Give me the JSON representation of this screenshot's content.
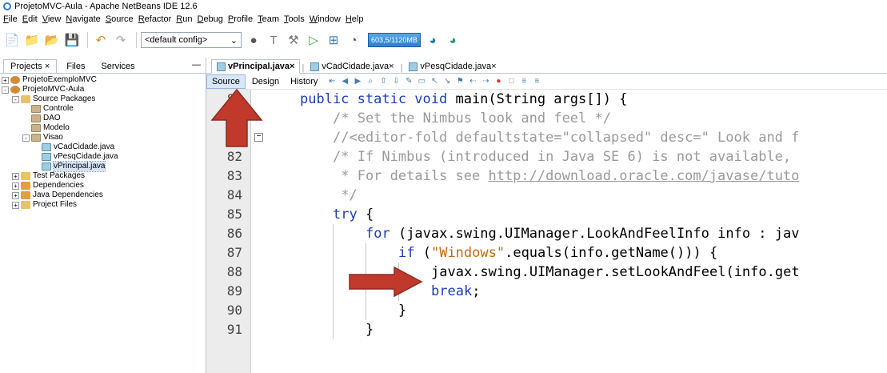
{
  "window": {
    "title": "ProjetoMVC-Aula - Apache NetBeans IDE 12.6"
  },
  "menu": [
    "File",
    "Edit",
    "View",
    "Navigate",
    "Source",
    "Refactor",
    "Run",
    "Debug",
    "Profile",
    "Team",
    "Tools",
    "Window",
    "Help"
  ],
  "toolbar": {
    "config_select": "<default config>",
    "memory": "603,5/1120MB",
    "icons": [
      "new-file-icon",
      "new-project-icon",
      "open-project-icon",
      "save-all-icon",
      "undo-icon",
      "redo-icon",
      "globe-icon",
      "clean-build-icon",
      "build-icon",
      "run-icon",
      "debug-icon",
      "profile-icon",
      "gc-icon",
      "gc2-icon"
    ]
  },
  "left_panel": {
    "tabs": [
      "Projects",
      "Files",
      "Services"
    ],
    "tree": [
      {
        "label": "ProjetoExemploMVC",
        "level": 0,
        "icon": "project",
        "expander": "+"
      },
      {
        "label": "ProjetoMVC-Aula",
        "level": 0,
        "icon": "project",
        "expander": "-"
      },
      {
        "label": "Source Packages",
        "level": 1,
        "icon": "folder",
        "expander": "-"
      },
      {
        "label": "Controle",
        "level": 2,
        "icon": "package",
        "expander": ""
      },
      {
        "label": "DAO",
        "level": 2,
        "icon": "package",
        "expander": ""
      },
      {
        "label": "Modelo",
        "level": 2,
        "icon": "package",
        "expander": ""
      },
      {
        "label": "Visao",
        "level": 2,
        "icon": "package",
        "expander": "-"
      },
      {
        "label": "vCadCidade.java",
        "level": 3,
        "icon": "java",
        "expander": ""
      },
      {
        "label": "vPesqCidade.java",
        "level": 3,
        "icon": "java",
        "expander": ""
      },
      {
        "label": "vPrincipal.java",
        "level": 3,
        "icon": "java",
        "expander": "",
        "selected": true
      },
      {
        "label": "Test Packages",
        "level": 1,
        "icon": "folder",
        "expander": "+"
      },
      {
        "label": "Dependencies",
        "level": 1,
        "icon": "lib",
        "expander": "+"
      },
      {
        "label": "Java Dependencies",
        "level": 1,
        "icon": "lib",
        "expander": "+"
      },
      {
        "label": "Project Files",
        "level": 1,
        "icon": "folder",
        "expander": "+"
      }
    ]
  },
  "editor": {
    "tabs": [
      {
        "label": "vPrincipal.java",
        "active": true
      },
      {
        "label": "vCadCidade.java",
        "active": false
      },
      {
        "label": "vPesqCidade.java",
        "active": false
      }
    ],
    "views": [
      "Source",
      "Design",
      "History"
    ],
    "active_view": "Source",
    "lines": [
      {
        "num": "80",
        "indent": 4,
        "parts": [
          [
            "kw",
            "public static void "
          ],
          [
            "",
            "main(String args[]) {"
          ]
        ]
      },
      {
        "num": "",
        "indent": 8,
        "parts": [
          [
            "cm",
            "/* Set the Nimbus look and feel */"
          ]
        ]
      },
      {
        "num": "81",
        "indent": 8,
        "parts": [
          [
            "cm",
            "//<editor-fold defaultstate=\"collapsed\" desc=\" Look and f"
          ]
        ],
        "fold": true
      },
      {
        "num": "82",
        "indent": 8,
        "parts": [
          [
            "cm",
            "/* If Nimbus (introduced in Java SE 6) is not available,"
          ]
        ]
      },
      {
        "num": "83",
        "indent": 8,
        "parts": [
          [
            "cm",
            " * For details see "
          ],
          [
            "link",
            "http://download.oracle.com/javase/tuto"
          ]
        ]
      },
      {
        "num": "84",
        "indent": 8,
        "parts": [
          [
            "cm",
            " */"
          ]
        ]
      },
      {
        "num": "85",
        "indent": 8,
        "parts": [
          [
            "kw",
            "try"
          ],
          [
            "",
            " {"
          ]
        ]
      },
      {
        "num": "86",
        "indent": 12,
        "parts": [
          [
            "kw",
            "for"
          ],
          [
            "",
            " (javax.swing.UIManager.LookAndFeelInfo info : jav"
          ]
        ]
      },
      {
        "num": "87",
        "indent": 16,
        "parts": [
          [
            "kw",
            "if"
          ],
          [
            "",
            " ("
          ],
          [
            "str",
            "\"Windows\""
          ],
          [
            "",
            ".equals(info.getName())) {"
          ]
        ]
      },
      {
        "num": "88",
        "indent": 20,
        "parts": [
          [
            "",
            "javax.swing.UIManager.setLookAndFeel(info.get"
          ]
        ]
      },
      {
        "num": "89",
        "indent": 20,
        "parts": [
          [
            "kw",
            "break"
          ],
          [
            "",
            ";"
          ]
        ]
      },
      {
        "num": "90",
        "indent": 16,
        "parts": [
          [
            "",
            "}"
          ]
        ]
      },
      {
        "num": "91",
        "indent": 12,
        "parts": [
          [
            "",
            "}"
          ]
        ]
      }
    ]
  },
  "colors": {
    "arrow_red": "#c0392b",
    "keyword": "#1f3cb0",
    "comment": "#9a9a9a",
    "string": "#c56a0e"
  }
}
